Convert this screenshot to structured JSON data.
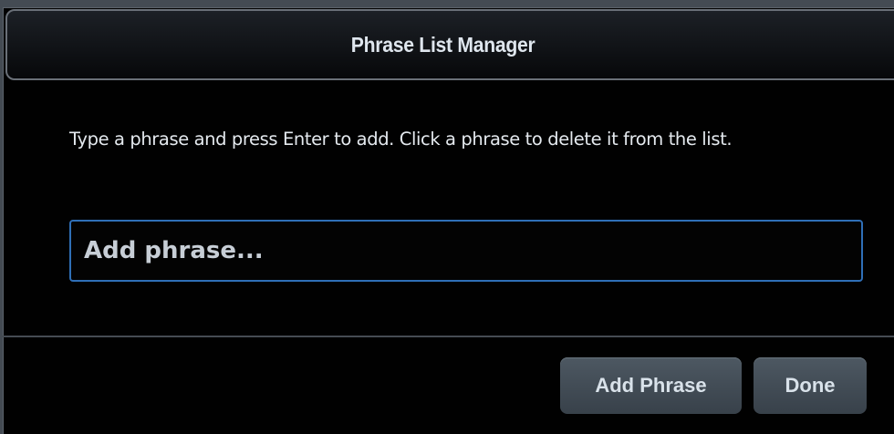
{
  "dialog": {
    "title": "Phrase List Manager",
    "instructions": "Type a phrase and press Enter to add. Click a phrase to delete it from the list.",
    "input": {
      "value": "",
      "placeholder": "Add phrase..."
    },
    "buttons": {
      "add_label": "Add Phrase",
      "done_label": "Done"
    }
  },
  "colors": {
    "background": "#010101",
    "input_border": "#2f6fb7",
    "button": "#434d57",
    "text": "#e4e9ee"
  }
}
